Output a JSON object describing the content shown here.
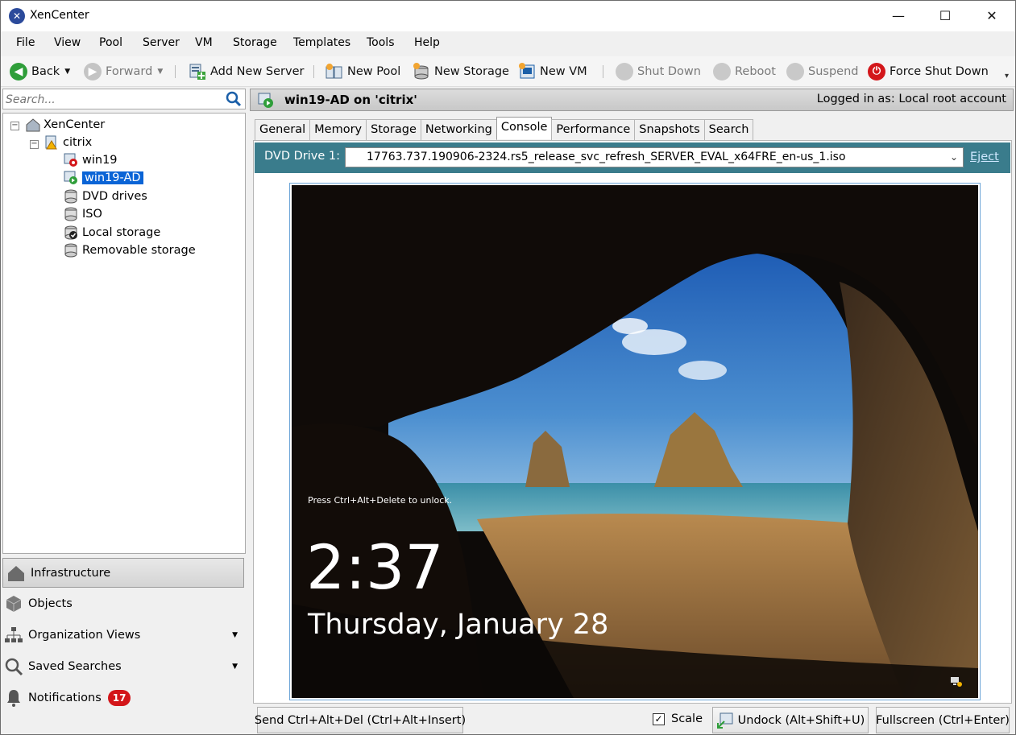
{
  "window": {
    "title": "XenCenter",
    "minimize": "—",
    "maximize": "☐",
    "close": "✕"
  },
  "menu": [
    "File",
    "View",
    "Pool",
    "Server",
    "VM",
    "Storage",
    "Templates",
    "Tools",
    "Help"
  ],
  "toolbar": {
    "back": "Back",
    "forward": "Forward",
    "add_server": "Add New Server",
    "new_pool": "New Pool",
    "new_storage": "New Storage",
    "new_vm": "New VM",
    "shut_down": "Shut Down",
    "reboot": "Reboot",
    "suspend": "Suspend",
    "force_shut_down": "Force Shut Down"
  },
  "search": {
    "placeholder": "Search..."
  },
  "tree": {
    "root": "XenCenter",
    "pool": "citrix",
    "items": [
      "win19",
      "win19-AD",
      "DVD drives",
      "ISO",
      "Local storage",
      "Removable storage"
    ],
    "selected": "win19-AD"
  },
  "nav": {
    "infrastructure": "Infrastructure",
    "objects": "Objects",
    "org_views": "Organization Views",
    "saved_searches": "Saved Searches",
    "notifications": "Notifications",
    "notifications_count": "17"
  },
  "vm_header": {
    "title": "win19-AD on 'citrix'",
    "login": "Logged in as: Local root account"
  },
  "tabs": [
    "General",
    "Memory",
    "Storage",
    "Networking",
    "Console",
    "Performance",
    "Snapshots",
    "Search"
  ],
  "active_tab": "Console",
  "dvd": {
    "label": "DVD Drive 1:",
    "value": "17763.737.190906-2324.rs5_release_svc_refresh_SERVER_EVAL_x64FRE_en-us_1.iso",
    "eject": "Eject"
  },
  "console": {
    "unlock_hint": "Press Ctrl+Alt+Delete to unlock.",
    "time": "2:37",
    "date": "Thursday, January 28"
  },
  "bottom": {
    "send_cad": "Send Ctrl+Alt+Del (Ctrl+Alt+Insert)",
    "scale": "Scale",
    "scale_checked": true,
    "undock": "Undock (Alt+Shift+U)",
    "fullscreen": "Fullscreen (Ctrl+Enter)"
  },
  "colors": {
    "selection": "#0a64d6",
    "dvd_bar": "#3a7c8c",
    "badge": "#d3161a"
  }
}
